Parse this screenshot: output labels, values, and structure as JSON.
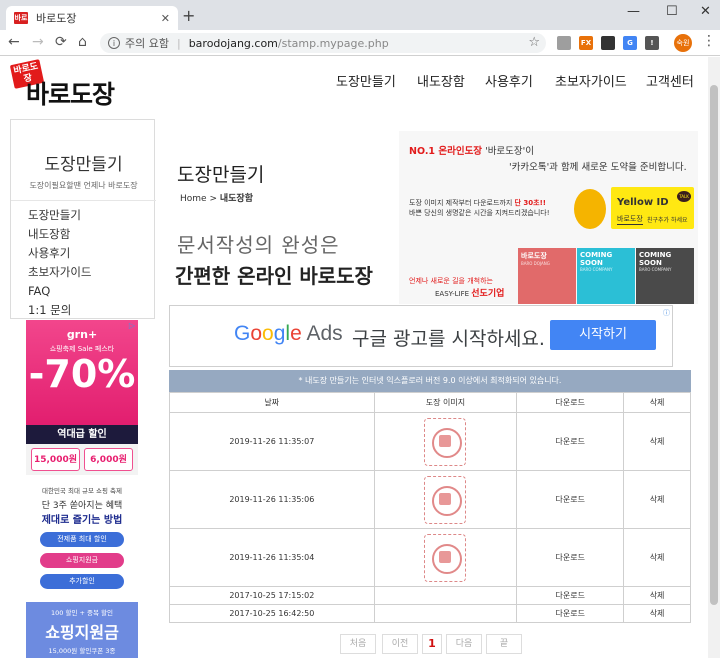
{
  "browser": {
    "tab_title": "바로도장",
    "tab_favicon": "바로",
    "close_tab": "✕",
    "new_tab": "+",
    "minimize": "—",
    "maximize": "☐",
    "close_window": "✕",
    "back": "←",
    "forward": "→",
    "reload": "⟳",
    "home": "⌂",
    "security_label": "주의 요함",
    "url_host": "barodojang.com",
    "url_path": "/stamp.mypage.php",
    "bookmark": "☆",
    "profile_initials": "숙원",
    "menu": "⋮",
    "extensions": [
      {
        "label": "",
        "color": "#9e9e9e"
      },
      {
        "label": "FX",
        "color": "#e8710a"
      },
      {
        "label": "",
        "color": "#333333"
      },
      {
        "label": "G",
        "color": "#4285f4"
      },
      {
        "label": "!",
        "color": "#555555"
      }
    ]
  },
  "site": {
    "logo_badge": "바로도장",
    "logo_text": "바로도장",
    "menu": [
      "도장만들기",
      "내도장함",
      "사용후기",
      "초보자가이드",
      "고객센터"
    ]
  },
  "sidebar": {
    "title": "도장만들기",
    "subtitle": "도장이필요할땐 언제나 바로도장",
    "items": [
      "도장만들기",
      "내도장함",
      "사용후기",
      "초보자가이드",
      "FAQ",
      "1:1 문의"
    ]
  },
  "ads": {
    "ad1": {
      "brand": "grn+",
      "line": "쇼핑축제 Sale 페스타",
      "big": "-70%",
      "dark": "역대급 할인",
      "coupon1": "15,000원",
      "coupon2": "6,000원"
    },
    "ad2": {
      "l1": "대한민국 최대 규모 쇼핑 축제",
      "l2": "단 3주 쏟아지는 혜택",
      "l3": "제대로 즐기는 방법",
      "pills": [
        "전제품 최대 할인",
        "쇼핑지원금",
        "추가할인"
      ]
    },
    "ad3": {
      "l1": "100 할인 + 중복 할인",
      "l2": "쇼핑지원금",
      "l3": "15,000원 할인쿠폰 3종"
    }
  },
  "content": {
    "page_title": "도장만들기",
    "breadcrumb_home": "Home",
    "breadcrumb_sep": ">",
    "breadcrumb_current": "내도장함",
    "slogan1": "문서작성의 완성은",
    "slogan2": "간편한 온라인 바로도장"
  },
  "banner": {
    "headline_red": "NO.1 온라인도장",
    "headline_rest": "'바로도장'이",
    "headline2": "'카카오톡'과 함께 새로운 도약을 준비합니다.",
    "body1_a": "도장 이미지 제작부터 다운로드까지",
    "body1_red": "단 30초!!",
    "body2": "바쁜 당신의 생명같은 시간을 지켜드리겠습니다!",
    "yellow_id": "Yellow ID",
    "yellow_name": "바로도장",
    "yellow_sub": "친구추가 하세요",
    "talk": "TALK",
    "tiles": [
      {
        "title": "바로도장",
        "sub": "BARO DOJANG",
        "color": "#e16a6a"
      },
      {
        "title": "COMING SOON",
        "sub": "BARO COMPANY",
        "color": "#2bbfd6"
      },
      {
        "title": "COMING SOON",
        "sub": "BARO COMPANY",
        "color": "#4a4a4a"
      }
    ],
    "foot1": "언제나 새로운 길을 개척하는",
    "foot2_a": "EASY-LIFE",
    "foot2_b": "선도기업"
  },
  "google_ad": {
    "logo": [
      "G",
      "o",
      "o",
      "g",
      "l",
      "e"
    ],
    "logo_colors": [
      "#4285f4",
      "#ea4335",
      "#fbbc05",
      "#4285f4",
      "#34a853",
      "#ea4335"
    ],
    "ads_word": "Ads",
    "text": "구글 광고를 시작하세요.",
    "button": "시작하기"
  },
  "notice": "* 내도장 만들기는 인터넷 익스플로러 버전 9.0 이상에서 최적화되어 있습니다.",
  "table": {
    "headers": [
      "날짜",
      "도장 이미지",
      "다운로드",
      "삭제"
    ],
    "rows": [
      {
        "date": "2019-11-26 11:35:07",
        "download": "다운로드",
        "delete": "삭제",
        "has_image": true
      },
      {
        "date": "2019-11-26 11:35:06",
        "download": "다운로드",
        "delete": "삭제",
        "has_image": true
      },
      {
        "date": "2019-11-26 11:35:04",
        "download": "다운로드",
        "delete": "삭제",
        "has_image": true
      },
      {
        "date": "2017-10-25 17:15:02",
        "download": "다운로드",
        "delete": "삭제",
        "has_image": false
      },
      {
        "date": "2017-10-25 16:42:50",
        "download": "다운로드",
        "delete": "삭제",
        "has_image": false
      }
    ]
  },
  "pagination": [
    "처음",
    "이전",
    "1",
    "다음",
    "끝"
  ]
}
